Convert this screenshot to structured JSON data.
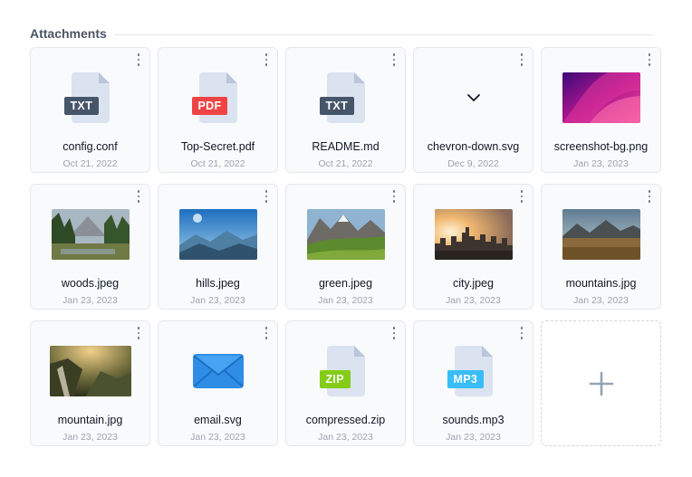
{
  "section": {
    "title": "Attachments"
  },
  "files": [
    {
      "name": "config.conf",
      "date": "Oct 21, 2022",
      "badge": "TXT",
      "badge_color": "#475569"
    },
    {
      "name": "Top-Secret.pdf",
      "date": "Oct 21, 2022",
      "badge": "PDF",
      "badge_color": "#ef4444"
    },
    {
      "name": "README.md",
      "date": "Oct 21, 2022",
      "badge": "TXT",
      "badge_color": "#475569"
    },
    {
      "name": "chevron-down.svg",
      "date": "Dec 9, 2022",
      "icon": "chevron-down-icon"
    },
    {
      "name": "screenshot-bg.png",
      "date": "Jan 23, 2023",
      "preview": "magenta-gradient-image"
    },
    {
      "name": "woods.jpeg",
      "date": "Jan 23, 2023",
      "preview": "forest-landscape-image"
    },
    {
      "name": "hills.jpeg",
      "date": "Jan 23, 2023",
      "preview": "blue-hills-image"
    },
    {
      "name": "green.jpeg",
      "date": "Jan 23, 2023",
      "preview": "green-valley-image"
    },
    {
      "name": "city.jpeg",
      "date": "Jan 23, 2023",
      "preview": "city-sunset-image"
    },
    {
      "name": "mountains.jpg",
      "date": "Jan 23, 2023",
      "preview": "mountain-plain-image"
    },
    {
      "name": "mountain.jpg",
      "date": "Jan 23, 2023",
      "preview": "mountain-waterfall-image"
    },
    {
      "name": "email.svg",
      "date": "Jan 23, 2023",
      "icon": "envelope-icon"
    },
    {
      "name": "compressed.zip",
      "date": "Jan 23, 2023",
      "badge": "ZIP",
      "badge_color": "#84cc16"
    },
    {
      "name": "sounds.mp3",
      "date": "Jan 23, 2023",
      "badge": "MP3",
      "badge_color": "#38bdf8"
    }
  ],
  "add_card": {
    "icon": "plus-icon"
  },
  "colors": {
    "card_bg": "#f8fafc",
    "border": "#e5e7eb",
    "date_text": "#9ca3af"
  }
}
